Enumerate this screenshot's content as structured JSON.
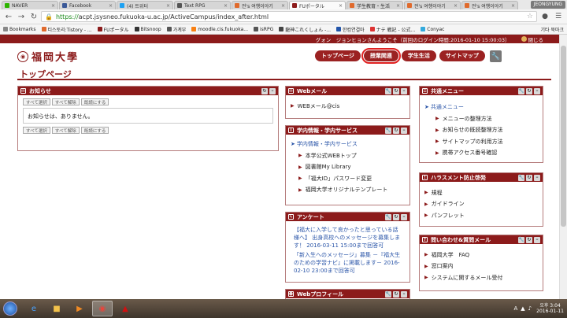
{
  "browser": {
    "tabs": [
      {
        "label": "NAVER",
        "color": "#2db400"
      },
      {
        "label": "Facebook",
        "color": "#3b5998"
      },
      {
        "label": "(4) 트위터",
        "color": "#1da1f2"
      },
      {
        "label": "Text RPG",
        "color": "#555555"
      },
      {
        "label": "전's 여행이야기",
        "color": "#e06a2c"
      },
      {
        "label": "FUポータル",
        "color": "#8c1b1b"
      },
      {
        "label": "学生教育・生活",
        "color": "#e06a2c"
      },
      {
        "label": "전's 여행이야기",
        "color": "#e06a2c"
      },
      {
        "label": "전's 여행이야기",
        "color": "#e06a2c"
      }
    ],
    "user_badge": "JEONGYUNG",
    "url_https": "https://",
    "url_rest": "acpt.jsysneo.fukuoka-u.ac.jp/ActiveCampus/index_after.html",
    "bookmarks": [
      {
        "label": "Bookmarks",
        "color": "#888888"
      },
      {
        "label": "티스토리:Tistory - ...",
        "color": "#e06a2c"
      },
      {
        "label": "FUポータル",
        "color": "#8c1b1b"
      },
      {
        "label": "Bitsnoop",
        "color": "#333333"
      },
      {
        "label": "가계부",
        "color": "#555555"
      },
      {
        "label": "moodle.cis.fukuoka...",
        "color": "#f98012"
      },
      {
        "label": "isRPG",
        "color": "#555555"
      },
      {
        "label": "龍神これくしょん -...",
        "color": "#444444"
      },
      {
        "label": "한컴연결마",
        "color": "#2255aa"
      },
      {
        "label": "ナテ 戦記 - 公式...",
        "color": "#d33"
      },
      {
        "label": "Conyac",
        "color": "#33aadd"
      }
    ],
    "bookmarks_other": "기타 북마크"
  },
  "site": {
    "welcome": "グォン　ジョンヒョンさんようこそ（前回のログイン時間:2016-01-10 15:00:03）",
    "close_label": "閉じる",
    "logo_text": "福岡大學",
    "nav": [
      "トップページ",
      "授業関連",
      "学生生活",
      "サイトマップ"
    ],
    "page_title": "トップページ"
  },
  "notice": {
    "title": "お知らせ",
    "buttons": [
      "すべて選択",
      "すべて解除",
      "既読にする"
    ],
    "message": "お知らせは、ありません。"
  },
  "webmail": {
    "title": "Webメール",
    "items": [
      "WEBメール@cis"
    ]
  },
  "info": {
    "title": "学内情報・学内サービス",
    "group": "学内情報・学内サービス",
    "items": [
      "本学公式WEBトップ",
      "図書館My Library",
      "「福大ID」パスワード変更",
      "福岡大学オリジナルテンプレート"
    ]
  },
  "survey": {
    "title": "アンケート",
    "text1": "【福大に入学して良かったと思っている話 様へ】 出身高校へのメッセージを募集します！ 2016-03-11 15:00まで回答可",
    "text2": "「新入生へのメッセージ」募集 －『福大生のための学習ナビ』に掲載します－ 2016-02-10 23:00まで回答可"
  },
  "profile": {
    "title": "Webプロフィール"
  },
  "common": {
    "title": "共通メニュー",
    "group": "共通メニュー",
    "items": [
      "メニューの整理方法",
      "お知らせの既読整理方法",
      "サイトマップの利用方法",
      "携帯アクセス番号確認"
    ]
  },
  "harassment": {
    "title": "ハラスメント防止啓発",
    "items": [
      "規程",
      "ガイドライン",
      "パンフレット"
    ]
  },
  "inquiry": {
    "title": "問い合わせ&質問メール",
    "items": [
      "福岡大学　FAQ",
      "窓口案内",
      "システムに関するメール受付"
    ]
  },
  "taskbar": {
    "lang": "A",
    "time": "오후 3:04",
    "date": "2016-01-11"
  }
}
